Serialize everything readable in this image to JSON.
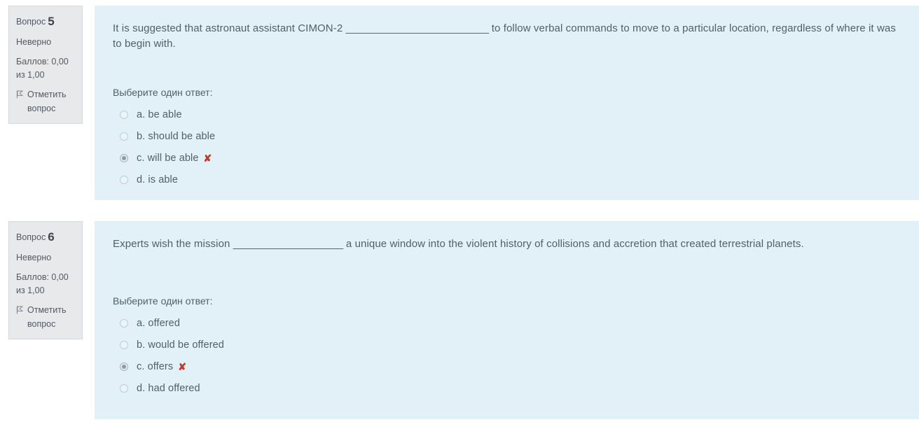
{
  "page": {
    "background_color": "#ffffff",
    "panel_color": "#e1f1f7",
    "sidebar_color": "#e7e9ea",
    "accent_wrong_color": "#c0392b",
    "text_color": "#4f6068"
  },
  "questions": [
    {
      "number_label": "Вопрос",
      "number": "5",
      "state": "Неверно",
      "marks": "Баллов: 0,00 из 1,00",
      "flag_label": "Отметить вопрос",
      "flag_icon": "flag-icon",
      "text_before_blank": "It is suggested that astronaut assistant CIMON-2 ",
      "blank": "__________________________",
      "text_after_blank": " to follow verbal commands to move to a particular location, regardless of where it was to begin with.",
      "answer_prompt": "Выберите один ответ:",
      "options": [
        {
          "label": "a. be able",
          "selected": false,
          "wrong": false
        },
        {
          "label": "b. should be able",
          "selected": false,
          "wrong": false
        },
        {
          "label": "c. will be able",
          "selected": true,
          "wrong": true,
          "wrong_mark": "✘"
        },
        {
          "label": "d. is able",
          "selected": false,
          "wrong": false
        }
      ]
    },
    {
      "number_label": "Вопрос",
      "number": "6",
      "state": "Неверно",
      "marks": "Баллов: 0,00 из 1,00",
      "flag_label": "Отметить вопрос",
      "flag_icon": "flag-icon",
      "text_before_blank": "Experts wish the mission ",
      "blank": "____________________",
      "text_after_blank": " a unique window into the violent history of collisions and accretion that created terrestrial planets.",
      "answer_prompt": "Выберите один ответ:",
      "options": [
        {
          "label": "a. offered",
          "selected": false,
          "wrong": false
        },
        {
          "label": "b. would be offered",
          "selected": false,
          "wrong": false
        },
        {
          "label": "c. offers",
          "selected": true,
          "wrong": true,
          "wrong_mark": "✘"
        },
        {
          "label": "d. had offered",
          "selected": false,
          "wrong": false
        }
      ]
    }
  ]
}
